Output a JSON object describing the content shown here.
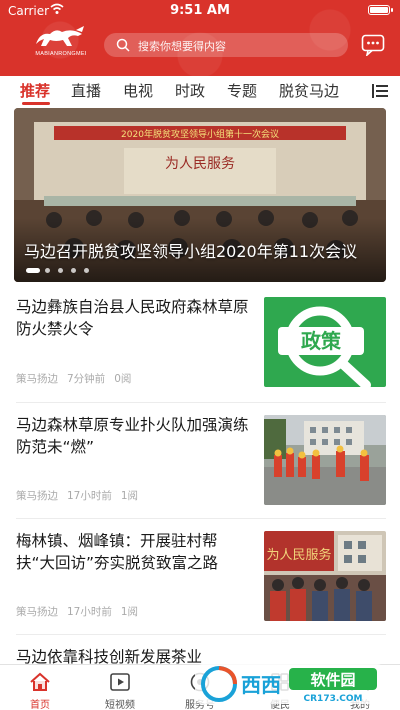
{
  "status_bar": {
    "carrier": "Carrier",
    "time": "9:51 AM"
  },
  "header": {
    "brand": "MABIANRONGMEI",
    "search_placeholder": "搜索你想要得内容"
  },
  "tabs": [
    {
      "label": "推荐",
      "active": true
    },
    {
      "label": "直播"
    },
    {
      "label": "电视"
    },
    {
      "label": "时政"
    },
    {
      "label": "专题"
    },
    {
      "label": "脱贫马边"
    }
  ],
  "banner": {
    "caption": "马边召开脱贫攻坚领导小组2020年第11次会议",
    "backdrop_banner": "2020年脱贫攻坚领导小组第十一次会议",
    "backdrop_slogan": "为人民服务",
    "slide_count": 5,
    "active_slide": 1
  },
  "news": [
    {
      "title": "马边彝族自治县人民政府森林草原防火禁火令",
      "source": "策马扬边",
      "time": "7分钟前",
      "reads": "0阅",
      "thumb_text": "政策",
      "thumb_color": "#2fa84f"
    },
    {
      "title": "马边森林草原专业扑火队加强演练防范未“燃”",
      "source": "策马扬边",
      "time": "17小时前",
      "reads": "1阅"
    },
    {
      "title": "梅林镇、烟峰镇：开展驻村帮扶“大回访”夯实脱贫致富之路",
      "source": "策马扬边",
      "time": "17小时前",
      "reads": "1阅",
      "thumb_slogan": "为人民服务"
    },
    {
      "title": "马边依靠科技创新发展茶业"
    }
  ],
  "bottom_nav": [
    {
      "label": "首页",
      "icon": "home-icon",
      "active": true
    },
    {
      "label": "短视频",
      "icon": "video-icon"
    },
    {
      "label": "服务号",
      "icon": "service-icon"
    },
    {
      "label": "便民",
      "icon": "convenience-icon"
    },
    {
      "label": "我的",
      "icon": "profile-icon"
    }
  ],
  "watermark": {
    "brand": "西西",
    "site_name": "软件园",
    "url": "CR173.COM"
  },
  "colors": {
    "accent": "#d9332b",
    "meta": "#aaaaaa",
    "policy_green": "#2fa84f"
  }
}
